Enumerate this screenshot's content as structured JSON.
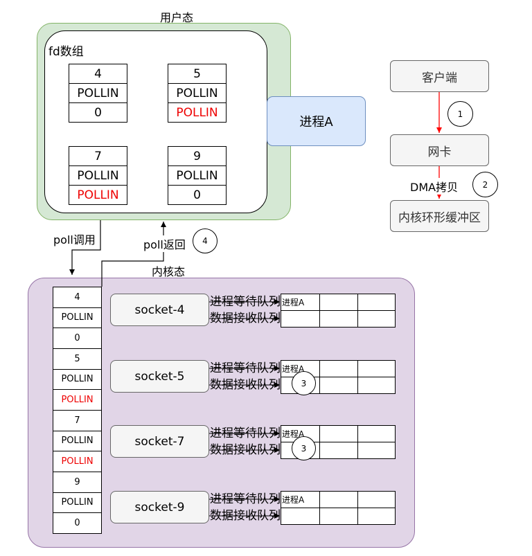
{
  "user_space": {
    "label": "用户态",
    "fd_array_title": "fd数组",
    "fd_entries": [
      {
        "fd": "4",
        "events": "POLLIN",
        "revents": "0",
        "revents_color": "#000000"
      },
      {
        "fd": "5",
        "events": "POLLIN",
        "revents": "POLLIN",
        "revents_color": "#ee0000"
      },
      {
        "fd": "7",
        "events": "POLLIN",
        "revents": "POLLIN",
        "revents_color": "#ee0000"
      },
      {
        "fd": "9",
        "events": "POLLIN",
        "revents": "0",
        "revents_color": "#000000"
      }
    ],
    "process_label": "进程A"
  },
  "network_flow": {
    "client": "客户端",
    "nic": "网卡",
    "ring_buffer": "内核环形缓冲区",
    "dma_label": "DMA拷贝",
    "step1": "1",
    "step2": "2"
  },
  "poll_arrows": {
    "call_label": "poll调用",
    "return_label": "poll返回",
    "step4": "4"
  },
  "kernel_space": {
    "label": "内核态",
    "fd_list": [
      {
        "text": "4",
        "color": "#000000"
      },
      {
        "text": "POLLIN",
        "color": "#000000"
      },
      {
        "text": "0",
        "color": "#000000"
      },
      {
        "text": "5",
        "color": "#000000"
      },
      {
        "text": "POLLIN",
        "color": "#000000"
      },
      {
        "text": "POLLIN",
        "color": "#ee0000"
      },
      {
        "text": "7",
        "color": "#000000"
      },
      {
        "text": "POLLIN",
        "color": "#000000"
      },
      {
        "text": "POLLIN",
        "color": "#ee0000"
      },
      {
        "text": "9",
        "color": "#000000"
      },
      {
        "text": "POLLIN",
        "color": "#000000"
      },
      {
        "text": "0",
        "color": "#000000"
      }
    ],
    "sockets": [
      {
        "name": "socket-4",
        "wait_queue_label": "进程等待队列",
        "recv_queue_label": "数据接收队列",
        "wait_entry": "进程A",
        "step": ""
      },
      {
        "name": "socket-5",
        "wait_queue_label": "进程等待队列",
        "recv_queue_label": "数据接收队列",
        "wait_entry": "进程A",
        "step": "3"
      },
      {
        "name": "socket-7",
        "wait_queue_label": "进程等待队列",
        "recv_queue_label": "数据接收队列",
        "wait_entry": "进程A",
        "step": "3"
      },
      {
        "name": "socket-9",
        "wait_queue_label": "进程等待队列",
        "recv_queue_label": "数据接收队列",
        "wait_entry": "进程A",
        "step": ""
      }
    ]
  },
  "colors": {
    "user_space_fill": "#d5e8d4",
    "kernel_space_fill": "#e1d5e7",
    "process_fill": "#dae8fc",
    "highlight_red": "#ee0000",
    "flow_arrow_red": "#ff0000"
  }
}
